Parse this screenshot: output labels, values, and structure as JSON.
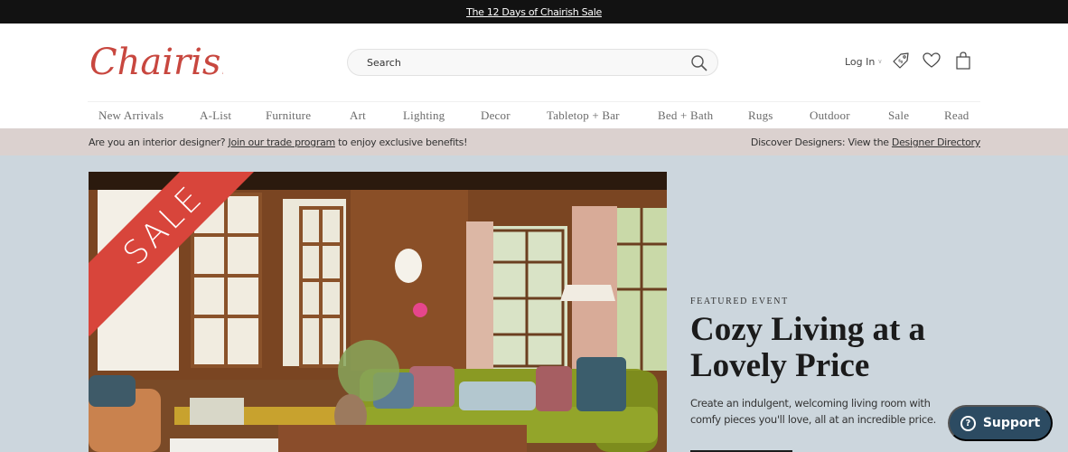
{
  "promo": {
    "label": "The 12 Days of Chairish Sale"
  },
  "header": {
    "logo_text": "Chairish",
    "brand_color": "#c8473f",
    "search": {
      "placeholder": "Search",
      "value": ""
    },
    "login_label": "Log In",
    "icons": [
      "price-tag-icon",
      "heart-icon",
      "shopping-bag-icon"
    ]
  },
  "nav": {
    "items": [
      {
        "label": "New Arrivals"
      },
      {
        "label": "A-List"
      },
      {
        "label": "Furniture"
      },
      {
        "label": "Art"
      },
      {
        "label": "Lighting"
      },
      {
        "label": "Decor"
      },
      {
        "label": "Tabletop + Bar"
      },
      {
        "label": "Bed + Bath"
      },
      {
        "label": "Rugs"
      },
      {
        "label": "Outdoor"
      },
      {
        "label": "Sale"
      },
      {
        "label": "Read"
      }
    ]
  },
  "trade_bar": {
    "left_prefix": "Are you an interior designer?",
    "left_link": "Join our trade program",
    "left_suffix": "to enjoy exclusive benefits!",
    "right_prefix": "Discover Designers: View the",
    "right_link": "Designer Directory"
  },
  "hero": {
    "badge": "SALE",
    "badge_color": "#d8453b",
    "background_color": "#ccd6dd",
    "eyebrow": "FEATURED EVENT",
    "headline": "Cozy Living at a Lovely Price",
    "blurb": "Create an indulgent, welcoming living room with comfy pieces you'll love, all at an incredible price."
  },
  "support": {
    "label": "Support",
    "color": "#2c4b62"
  }
}
